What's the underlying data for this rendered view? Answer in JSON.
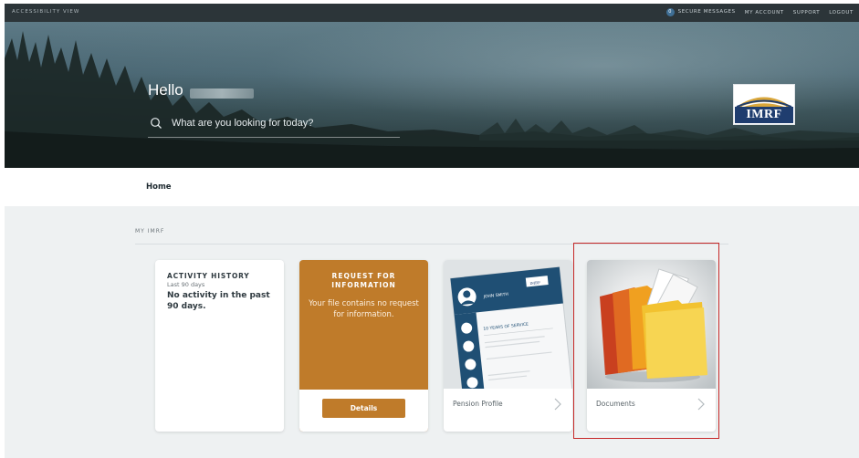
{
  "topbar": {
    "accessibility_view": "ACCESSIBILITY VIEW",
    "message_count": "0",
    "secure_messages": "SECURE MESSAGES",
    "my_account": "MY ACCOUNT",
    "support": "SUPPORT",
    "logout": "LOGOUT"
  },
  "hero": {
    "greeting": "Hello",
    "search_placeholder": "What are you looking for today?",
    "logo_text": "IMRF"
  },
  "breadcrumb": {
    "home": "Home"
  },
  "section": {
    "title": "MY IMRF"
  },
  "cards": {
    "activity": {
      "title": "ACTIVITY HISTORY",
      "subtitle": "Last 90 days",
      "message": "No activity in the past 90 days."
    },
    "request": {
      "title": "REQUEST FOR INFORMATION",
      "message": "Your file contains no request for information.",
      "button": "Details"
    },
    "pension": {
      "label": "Pension Profile",
      "image": {
        "name": "JOHN SMITH",
        "logo": "IMRF",
        "service": "10 YEARS OF SERVICE"
      }
    },
    "documents": {
      "label": "Documents"
    }
  },
  "colors": {
    "topbar": "#2c3539",
    "accent_orange": "#bf7b2a",
    "logo_blue": "#1f3d6f",
    "highlight_red": "#c62828",
    "content_bg": "#eef1f2"
  },
  "icons": {
    "search": "search-icon",
    "chevron": "chevron-right-icon",
    "user": "user-icon",
    "location": "location-icon",
    "home": "home-icon",
    "phone": "phone-icon"
  }
}
